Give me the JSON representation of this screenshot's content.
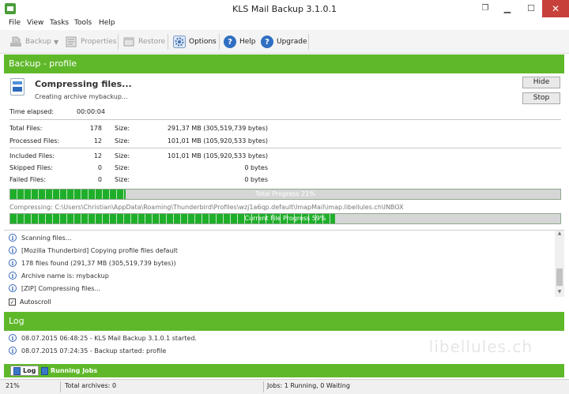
{
  "window": {
    "title": "KLS Mail Backup 3.1.0.1",
    "minimize": "▁",
    "maximize": "☐",
    "close": "✕",
    "restore_glyph": "❐"
  },
  "menu": [
    "File",
    "View",
    "Tasks",
    "Tools",
    "Help"
  ],
  "toolbar": {
    "backup": "Backup",
    "properties": "Properties",
    "restore": "Restore",
    "options": "Options",
    "help": "Help",
    "upgrade": "Upgrade"
  },
  "section": {
    "title": "Backup - profile",
    "log_title": "Log"
  },
  "status": {
    "title": "Compressing files...",
    "subtitle": "Creating archive mybackup..."
  },
  "buttons": {
    "hide": "Hide",
    "stop": "Stop"
  },
  "stats": {
    "time_elapsed_label": "Time elapsed:",
    "time_elapsed_value": "00:00:04",
    "size_label": "Size:",
    "rows": [
      {
        "label": "Total Files:",
        "count": "178",
        "size": "291,37 MB (305,519,739 bytes)"
      },
      {
        "label": "Processed Files:",
        "count": "12",
        "size": "101,01 MB (105,920,533 bytes)"
      },
      {
        "label": "Included Files:",
        "count": "12",
        "size": "101,01 MB (105,920,533 bytes)"
      },
      {
        "label": "Skipped Files:",
        "count": "0",
        "size": "0 bytes"
      },
      {
        "label": "Failed Files:",
        "count": "0",
        "size": "0 bytes"
      }
    ]
  },
  "progress": {
    "total_label": "Total Progress 21%",
    "total_fraction": 0.21,
    "compressing_path": "Compressing: C:\\Users\\Christian\\AppData\\Roaming\\Thunderbird\\Profiles\\wzj1a6qp.default\\ImapMail\\imap.libellules.ch\\INBOX",
    "file_label": "Current File Progress 59%",
    "file_fraction": 0.59
  },
  "messages": [
    "Scanning files...",
    "[Mozilla Thunderbird] Copying profile files default",
    "178 files found (291,37 MB (305,519,739 bytes))",
    "Archive name is: mybackup",
    "[ZIP] Compressing files..."
  ],
  "autoscroll": {
    "label": "Autoscroll",
    "checked": "✓"
  },
  "log": [
    "08.07.2015 06:48:25 - KLS Mail Backup 3.1.0.1 started.",
    "08.07.2015 07:24:35 - Backup started: profile"
  ],
  "watermark": "libellules.ch",
  "tabs": {
    "log": "Log",
    "jobs": "Running Jobs"
  },
  "statusbar": {
    "percent": "21%",
    "archives": "Total archives: 0",
    "jobs": "Jobs: 1 Running, 0 Waiting"
  },
  "icons": {
    "backup": "backup-icon",
    "dropdown": "chevron-down-icon",
    "properties": "properties-icon",
    "restore": "restore-icon",
    "options": "gear-icon",
    "help": "help-icon",
    "upgrade": "upgrade-icon",
    "info": "info-icon"
  },
  "colors": {
    "accent_green": "#5fb82a",
    "progress_green": "#1fae2a",
    "close_red": "#c7413a",
    "icon_blue": "#2f6fc2"
  }
}
